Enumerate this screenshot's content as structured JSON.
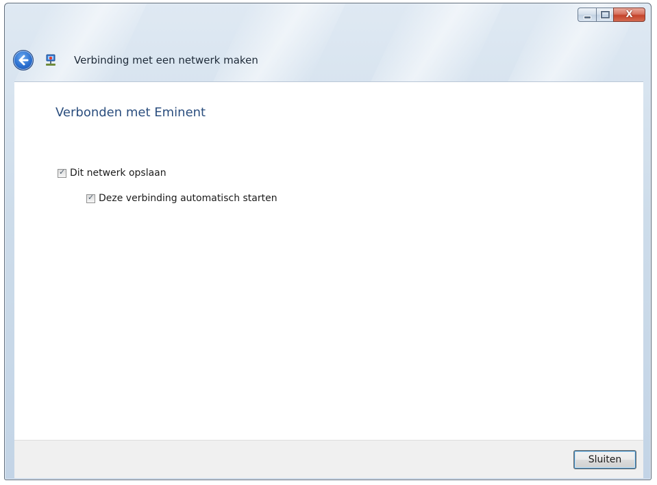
{
  "window": {
    "title": "Verbinding met een netwerk maken",
    "controls": {
      "minimize_icon": "minimize-icon",
      "maximize_icon": "maximize-icon",
      "close_icon": "close-icon",
      "close_glyph": "X"
    }
  },
  "content": {
    "heading": "Verbonden met Eminent",
    "options": [
      {
        "label": "Dit netwerk opslaan",
        "checked": true
      },
      {
        "label": "Deze verbinding automatisch starten",
        "checked": true
      }
    ]
  },
  "footer": {
    "close_button_label": "Sluiten"
  },
  "colors": {
    "heading": "#2b4e7e",
    "close_button_red": "#c5432b",
    "back_button_blue": "#2a6fcf"
  }
}
